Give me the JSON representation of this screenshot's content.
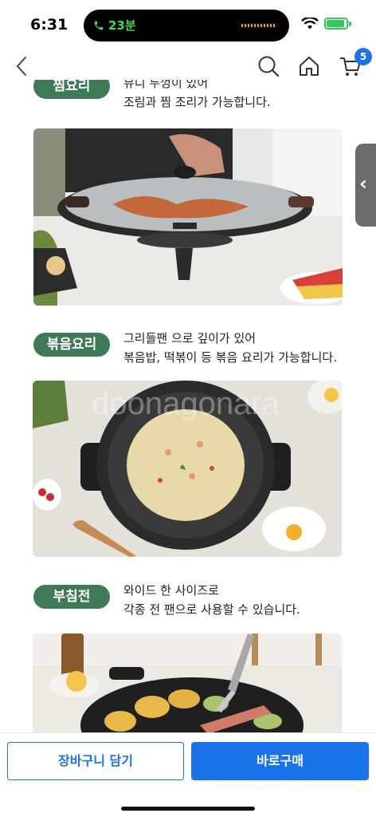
{
  "status_bar": {
    "time": "6:31",
    "call_timer": "23분"
  },
  "nav": {
    "cart_count": "5",
    "accent_color": "#1a73e8"
  },
  "sections": [
    {
      "label": "찜요리",
      "desc_line1": "뮤디 두껑이 있어",
      "desc_line2": "조림과 찜 조리가 가능합니다.",
      "photo": "lidded-grill-pan-steaming"
    },
    {
      "label": "볶음요리",
      "desc_line1": "그리들팬 으로 깊이가 있어",
      "desc_line2": "볶음밥, 떡볶이 등 볶음 요리가 가능합니다.",
      "photo": "fried-rice-in-pan"
    },
    {
      "label": "부침전",
      "desc_line1": "와이드 한 사이즈로",
      "desc_line2": "각종 전 팬으로 사용할 수 있습니다.",
      "photo": "pancakes-on-pan"
    }
  ],
  "watermark": "doonagonara",
  "bottom_bar": {
    "add_to_cart": "장바구니 담기",
    "buy_now": "바로구매"
  },
  "colors": {
    "label_green": "#3d7a55",
    "primary_blue": "#1a73e8"
  }
}
